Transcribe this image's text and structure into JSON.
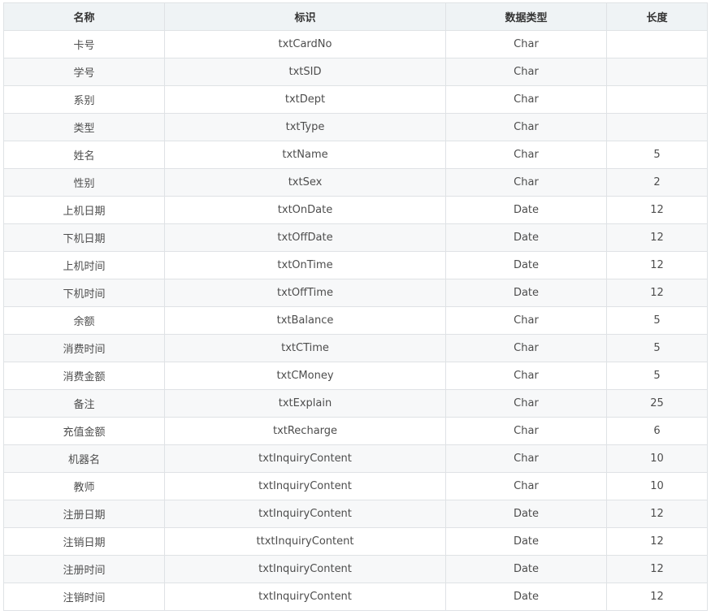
{
  "table": {
    "headers": [
      "名称",
      "标识",
      "数据类型",
      "长度"
    ],
    "rows": [
      [
        "卡号",
        "txtCardNo",
        "Char",
        ""
      ],
      [
        "学号",
        "txtSID",
        "Char",
        ""
      ],
      [
        "系别",
        "txtDept",
        "Char",
        ""
      ],
      [
        "类型",
        "txtType",
        "Char",
        ""
      ],
      [
        "姓名",
        "txtName",
        "Char",
        "5"
      ],
      [
        "性别",
        "txtSex",
        "Char",
        "2"
      ],
      [
        "上机日期",
        "txtOnDate",
        "Date",
        "12"
      ],
      [
        "下机日期",
        "txtOffDate",
        "Date",
        "12"
      ],
      [
        "上机时间",
        "txtOnTime",
        "Date",
        "12"
      ],
      [
        "下机时间",
        "txtOffTime",
        "Date",
        "12"
      ],
      [
        "余额",
        "txtBalance",
        "Char",
        "5"
      ],
      [
        "消费时间",
        "txtCTime",
        "Char",
        "5"
      ],
      [
        "消费金额",
        "txtCMoney",
        "Char",
        "5"
      ],
      [
        "备注",
        "txtExplain",
        "Char",
        "25"
      ],
      [
        "充值金额",
        "txtRecharge",
        "Char",
        "6"
      ],
      [
        "机器名",
        "txtInquiryContent",
        "Char",
        "10"
      ],
      [
        "教师",
        "txtInquiryContent",
        "Char",
        "10"
      ],
      [
        "注册日期",
        "txtInquiryContent",
        "Date",
        "12"
      ],
      [
        "注销日期",
        "ttxtInquiryContent",
        "Date",
        "12"
      ],
      [
        "注册时间",
        "txtInquiryContent",
        "Date",
        "12"
      ],
      [
        "注销时间",
        "txtInquiryContent",
        "Date",
        "12"
      ]
    ]
  }
}
